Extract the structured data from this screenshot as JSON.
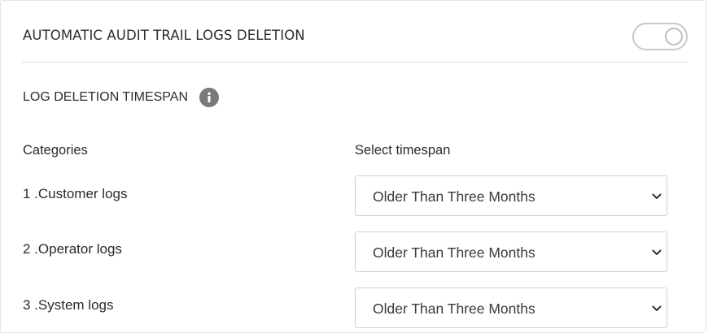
{
  "header": {
    "title": "AUTOMATIC AUDIT TRAIL LOGS DELETION",
    "toggle_state": "off"
  },
  "section": {
    "title": "LOG DELETION TIMESPAN",
    "info_icon": "info-icon"
  },
  "columns": {
    "categories": "Categories",
    "timespan": "Select timespan"
  },
  "rows": [
    {
      "label": "1 .Customer logs",
      "selected": "Older Than Three Months"
    },
    {
      "label": "2 .Operator logs",
      "selected": "Older Than Three Months"
    },
    {
      "label": "3 .System logs",
      "selected": "Older Than Three Months"
    }
  ],
  "colors": {
    "border": "#cfcfcf",
    "info_icon_bg": "#7a7a7a",
    "text": "#2b2b2b"
  }
}
